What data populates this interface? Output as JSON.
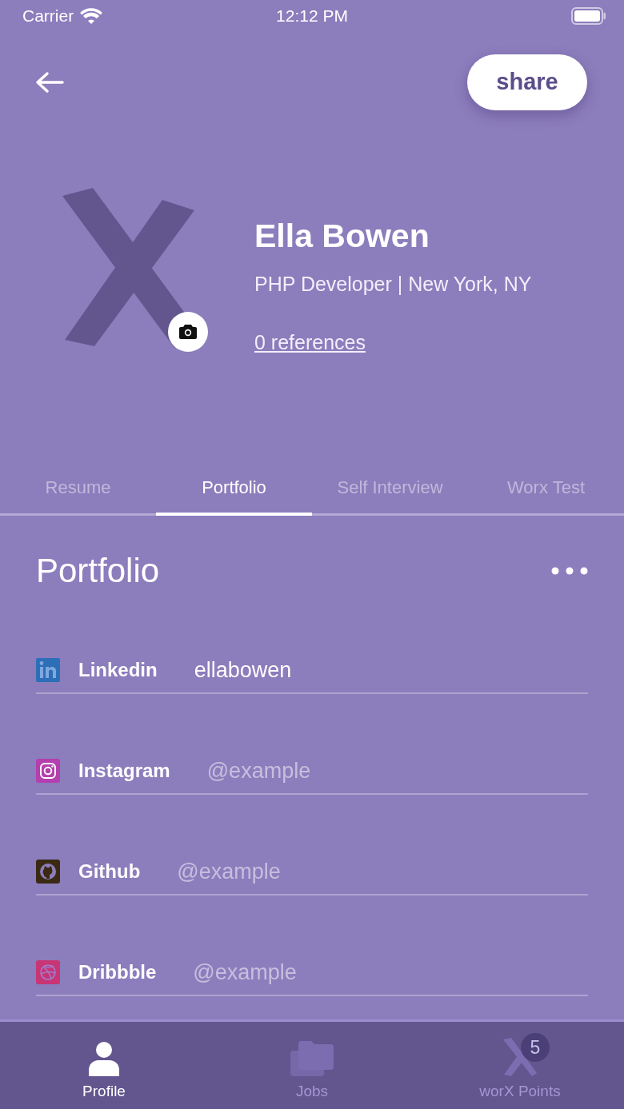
{
  "status_bar": {
    "carrier": "Carrier",
    "time": "12:12 PM"
  },
  "header": {
    "share_button": "share"
  },
  "profile": {
    "name": "Ella Bowen",
    "subtitle": "PHP Developer | New York, NY",
    "references_link": "0 references"
  },
  "tabs": [
    {
      "label": "Resume",
      "selected": false
    },
    {
      "label": "Portfolio",
      "selected": true
    },
    {
      "label": "Self Interview",
      "selected": false
    },
    {
      "label": "Worx Test",
      "selected": false
    }
  ],
  "portfolio": {
    "title": "Portfolio",
    "links": [
      {
        "kind": "linkedin",
        "label": "Linkedin",
        "value": "ellabowen"
      },
      {
        "kind": "instagram",
        "label": "Instagram",
        "placeholder": "@example"
      },
      {
        "kind": "github",
        "label": "Github",
        "placeholder": "@example"
      },
      {
        "kind": "dribbble",
        "label": "Dribbble",
        "placeholder": "@example"
      }
    ]
  },
  "bottom_nav": [
    {
      "kind": "profile",
      "label": "Profile",
      "selected": true
    },
    {
      "kind": "jobs",
      "label": "Jobs",
      "selected": false
    },
    {
      "kind": "points",
      "label": "worX Points",
      "selected": false,
      "badge": "5"
    }
  ]
}
